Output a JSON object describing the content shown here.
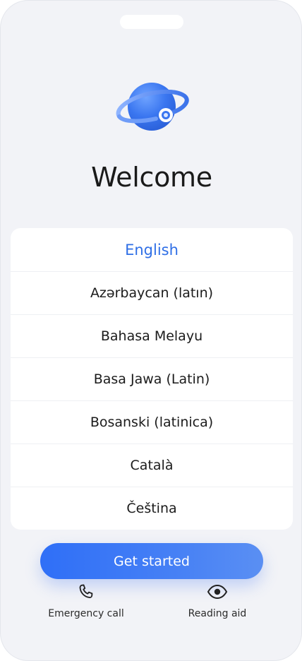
{
  "welcome": {
    "title": "Welcome",
    "logo_icon": "globe-orbit-icon"
  },
  "languages": {
    "selected": "English",
    "items": [
      {
        "label": "English",
        "selected": true
      },
      {
        "label": "Azərbaycan (latın)",
        "selected": false
      },
      {
        "label": "Bahasa Melayu",
        "selected": false
      },
      {
        "label": "Basa Jawa (Latin)",
        "selected": false
      },
      {
        "label": "Bosanski (latinica)",
        "selected": false
      },
      {
        "label": "Català",
        "selected": false
      },
      {
        "label": "Čeština",
        "selected": false
      }
    ]
  },
  "actions": {
    "get_started_label": "Get started",
    "emergency_call_label": "Emergency call",
    "emergency_call_icon": "phone-icon",
    "reading_aid_label": "Reading aid",
    "reading_aid_icon": "eye-icon"
  },
  "colors": {
    "accent": "#2f6fe6",
    "background": "#f2f3f7",
    "button_gradient_start": "#2f6ff7",
    "button_gradient_end": "#5a8ff3"
  }
}
